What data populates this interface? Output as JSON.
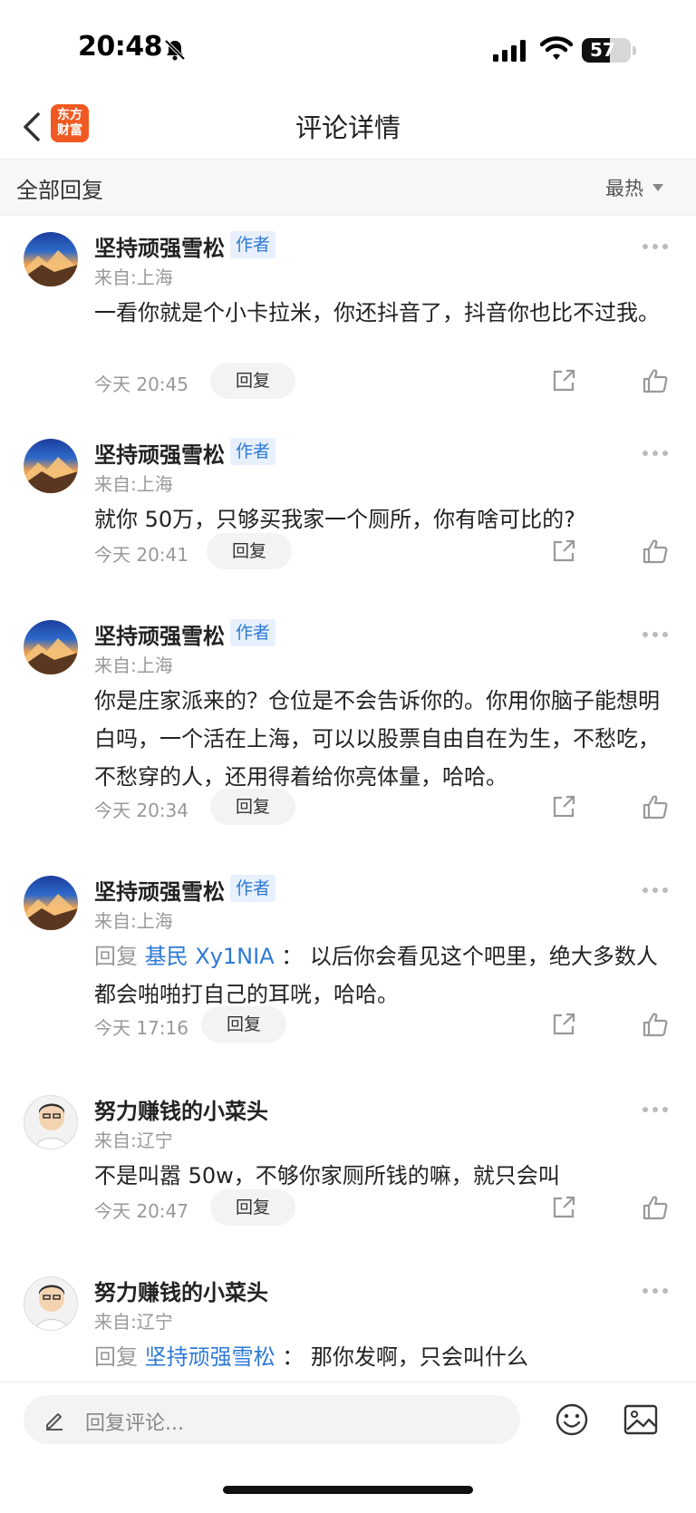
{
  "status_bar": {
    "time": "20:48",
    "battery_level": "57"
  },
  "nav": {
    "logo_line1": "东方",
    "logo_line2": "财富",
    "title": "评论详情"
  },
  "filter": {
    "label": "全部回复",
    "sort": "最热"
  },
  "comments": [
    {
      "user": "坚持顽强雪松",
      "tag": "作者",
      "location": "来自:上海",
      "text": "一看你就是个小卡拉米，你还抖音了，抖音你也比不过我。",
      "time": "今天 20:45",
      "reply_label": "回复"
    },
    {
      "user": "坚持顽强雪松",
      "tag": "作者",
      "location": "来自:上海",
      "text": "就你 50万，只够买我家一个厕所，你有啥可比的?",
      "time": "今天 20:41",
      "reply_label": "回复"
    },
    {
      "user": "坚持顽强雪松",
      "tag": "作者",
      "location": "来自:上海",
      "text": "你是庄家派来的？仓位是不会告诉你的。你用你脑子能想明白吗，一个活在上海，可以以股票自由自在为生，不愁吃，不愁穿的人，还用得着给你亮体量，哈哈。",
      "time": "今天 20:34",
      "reply_label": "回复"
    },
    {
      "user": "坚持顽强雪松",
      "tag": "作者",
      "location": "来自:上海",
      "reply_prefix": "回复",
      "reply_target": "基民 Xy1NIA",
      "text": "： 以后你会看见这个吧里，绝大多数人都会啪啪打自己的耳咣，哈哈。",
      "time": "今天 17:16",
      "reply_label": "回复"
    },
    {
      "user": "努力赚钱的小菜头",
      "location": "来自:辽宁",
      "text": "不是叫嚣 50w，不够你家厕所钱的嘛，就只会叫",
      "time": "今天 20:47",
      "reply_label": "回复"
    },
    {
      "user": "努力赚钱的小菜头",
      "location": "来自:辽宁",
      "reply_prefix": "回复",
      "reply_target": "坚持顽强雪松",
      "text": "： 那你发啊，只会叫什么"
    }
  ],
  "bottom_bar": {
    "placeholder": "回复评论..."
  },
  "icons": {
    "back": "chevron-left-icon",
    "more": "more-dots-icon",
    "share": "share-icon",
    "like": "thumbs-up-icon",
    "pencil": "pencil-icon",
    "emoji": "emoji-icon",
    "image": "image-icon"
  },
  "colors": {
    "brand": "#f05a22",
    "link": "#2d79d6",
    "muted": "#999999"
  }
}
